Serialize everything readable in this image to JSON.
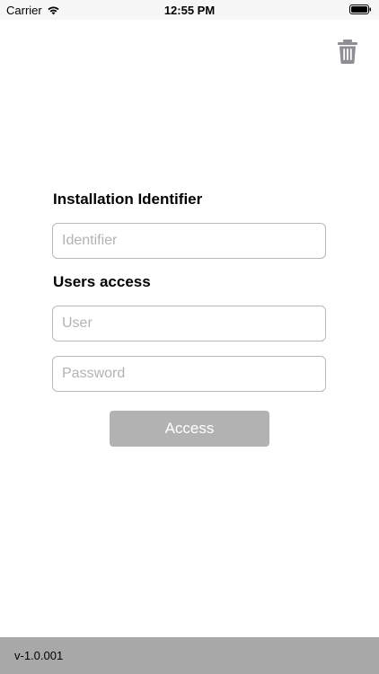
{
  "status_bar": {
    "carrier": "Carrier",
    "time": "12:55 PM",
    "wifi_icon": "wifi-icon",
    "battery_icon": "battery-full-icon"
  },
  "toolbar": {
    "trash_icon": "trash-icon",
    "icon_color": "#8e8e93"
  },
  "installation": {
    "label": "Installation Identifier",
    "identifier_placeholder": "Identifier",
    "identifier_value": ""
  },
  "users_access": {
    "label": "Users access",
    "user_placeholder": "User",
    "user_value": "",
    "password_placeholder": "Password",
    "password_value": ""
  },
  "access_button": {
    "label": "Access",
    "background": "#b2b2b2"
  },
  "footer": {
    "version": "v-1.0.001",
    "background": "#a8a8a8"
  }
}
